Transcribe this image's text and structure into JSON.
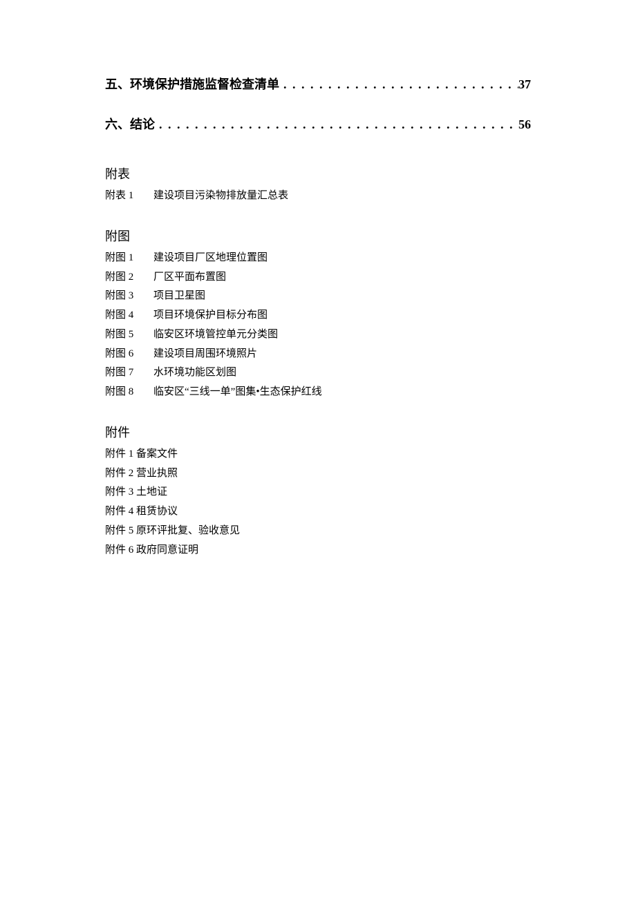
{
  "toc": [
    {
      "title": "五、环境保护措施监督检查清单",
      "page": "37"
    },
    {
      "title": "六、结论",
      "page": "56"
    }
  ],
  "leader": ". . . . . . . . . . . . . . . . . . . . . . . . . . . . . . . . . . . . . . . . . . . . . . . . . . . . . . . . . . . . . . . . . . . . . . . . . . . . . . . . . . . .",
  "sections": {
    "futu_heading": "附表",
    "futu_items": [
      {
        "label": "附表 1",
        "desc": "建设项目污染物排放量汇总表"
      }
    ],
    "futu2_heading": "附图",
    "futu2_items": [
      {
        "label": "附图 1",
        "desc": "建设项目厂区地理位置图"
      },
      {
        "label": "附图 2",
        "desc": "厂区平面布置图"
      },
      {
        "label": "附图 3",
        "desc": "项目卫星图"
      },
      {
        "label": "附图 4",
        "desc": "项目环境保护目标分布图"
      },
      {
        "label": "附图 5",
        "desc": "临安区环境管控单元分类图"
      },
      {
        "label": "附图 6",
        "desc": "建设项目周围环境照片"
      },
      {
        "label": "附图 7",
        "desc": "水环境功能区划图"
      },
      {
        "label": "附图 8",
        "desc": "临安区“三线一单”图集•生态保护红线"
      }
    ],
    "fujian_heading": "附件",
    "fujian_items": [
      "附件 1 备案文件",
      "附件 2 营业执照",
      "附件 3 土地证",
      "附件 4 租赁协议",
      "附件 5 原环评批复、验收意见",
      "附件 6 政府同意证明"
    ]
  }
}
